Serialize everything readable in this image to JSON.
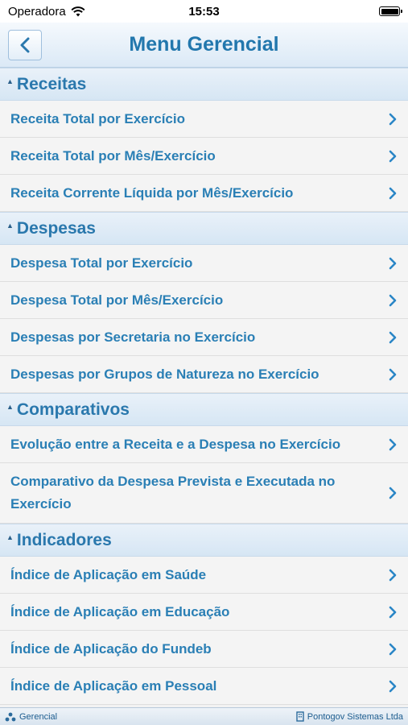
{
  "status_bar": {
    "carrier": "Operadora",
    "time": "15:53"
  },
  "navbar": {
    "title": "Menu Gerencial"
  },
  "sections": [
    {
      "title": "Receitas",
      "items": [
        {
          "label": "Receita Total por Exercício"
        },
        {
          "label": "Receita Total por Mês/Exercício"
        },
        {
          "label": "Receita Corrente Líquida por Mês/Exercício"
        }
      ]
    },
    {
      "title": "Despesas",
      "items": [
        {
          "label": "Despesa Total por Exercício"
        },
        {
          "label": "Despesa Total por Mês/Exercício"
        },
        {
          "label": "Despesas por Secretaria no Exercício"
        },
        {
          "label": "Despesas por Grupos de Natureza no Exercício"
        }
      ]
    },
    {
      "title": "Comparativos",
      "items": [
        {
          "label": "Evolução entre a Receita e a Despesa no Exercício"
        },
        {
          "label": "Comparativo da Despesa Prevista e Executada no Exercício"
        }
      ]
    },
    {
      "title": "Indicadores",
      "items": [
        {
          "label": "Índice de Aplicação em Saúde"
        },
        {
          "label": "Índice de Aplicação em Educação"
        },
        {
          "label": "Índice de Aplicação do Fundeb"
        },
        {
          "label": "Índice de Aplicação em Pessoal"
        }
      ]
    }
  ],
  "footer": {
    "left": "Gerencial",
    "right": "Pontogov Sistemas Ltda"
  }
}
